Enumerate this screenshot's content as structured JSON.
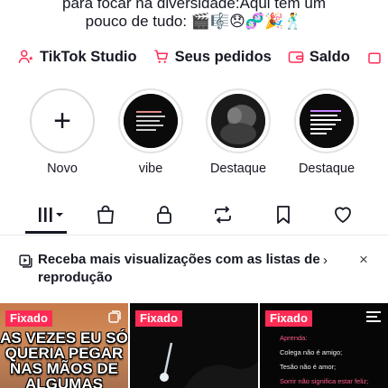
{
  "bio": {
    "line1": "para focar na diversidade:Aqui tem um",
    "line2": "pouco de tudo: 🎬🎼😞🧬🎉🕺"
  },
  "quick_links": [
    {
      "label": "TikTok Studio",
      "icon": "person-star-icon"
    },
    {
      "label": "Seus pedidos",
      "icon": "cart-icon"
    },
    {
      "label": "Saldo",
      "icon": "wallet-icon"
    }
  ],
  "highlights": [
    {
      "label": "Novo",
      "icon": "plus-icon"
    },
    {
      "label": "vibe"
    },
    {
      "label": "Destaque"
    },
    {
      "label": "Destaque"
    }
  ],
  "tabs": [
    {
      "name": "videos",
      "icon": "grid-bars-icon"
    },
    {
      "name": "shop",
      "icon": "bag-icon"
    },
    {
      "name": "private",
      "icon": "lock-icon"
    },
    {
      "name": "reposts",
      "icon": "repost-icon"
    },
    {
      "name": "favorites",
      "icon": "bookmark-icon"
    },
    {
      "name": "liked",
      "icon": "heart-icon"
    }
  ],
  "promo": {
    "text": "Receba mais visualizações com as listas de reprodução",
    "chevron": "›",
    "close": "×"
  },
  "videos": [
    {
      "badge": "Fixado",
      "caption": "AS VEZES EU SÓ QUERIA PEGAR NAS MÃOS DE ALGUMAS"
    },
    {
      "badge": "Fixado"
    },
    {
      "badge": "Fixado",
      "lines": [
        "Aprenda:",
        "Colega não é amigo;",
        "Tesão não é amor;",
        "Sorrir não significa estar feliz;"
      ]
    }
  ],
  "colors": {
    "accent": "#fe2c55",
    "text": "#161823"
  }
}
